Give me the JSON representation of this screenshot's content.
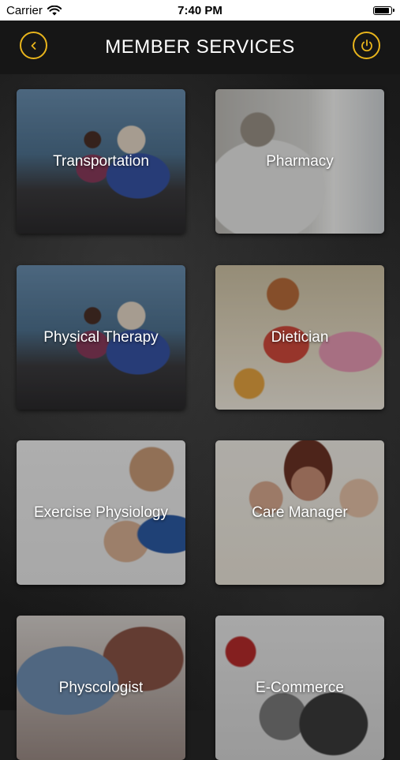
{
  "status_bar": {
    "carrier": "Carrier",
    "time": "7:40 PM"
  },
  "header": {
    "title": "MEMBER SERVICES",
    "back_icon": "chevron-left-icon",
    "power_icon": "power-icon",
    "accent_color": "#e8b41c"
  },
  "services": [
    {
      "label": "Transportation"
    },
    {
      "label": "Pharmacy"
    },
    {
      "label": "Physical Therapy"
    },
    {
      "label": "Dietician"
    },
    {
      "label": "Exercise Physiology"
    },
    {
      "label": "Care Manager"
    },
    {
      "label": "Physcologist"
    },
    {
      "label": "E-Commerce"
    }
  ]
}
